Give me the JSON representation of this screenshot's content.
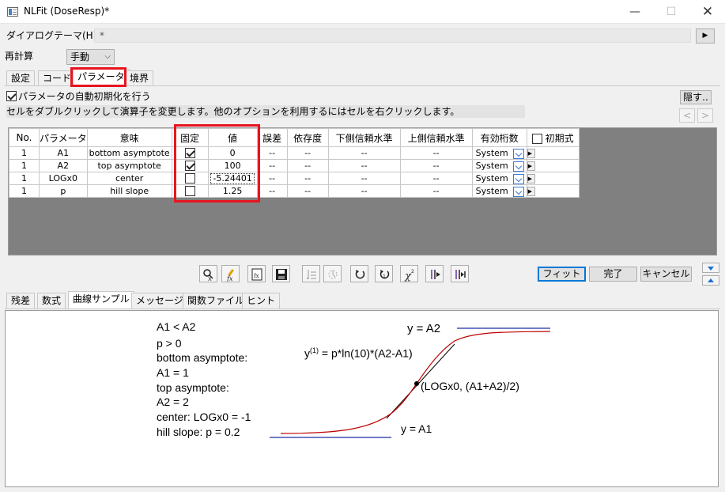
{
  "window": {
    "title": "NLFit (DoseResp)*",
    "minimize": "—",
    "maximize": "☐",
    "close": "✕"
  },
  "theme": {
    "label": "ダイアログテーマ(H)",
    "value": "*",
    "arrow": "▶"
  },
  "recalc": {
    "label": "再計算",
    "value": "手動"
  },
  "top_tabs": [
    "設定",
    "コード",
    "パラメータ",
    "境界"
  ],
  "params_tab": {
    "auto_init_label": "パラメータの自動初期化を行う",
    "auto_init_checked": true,
    "hint": "セルをダブルクリックして演算子を変更します。他のオプションを利用するにはセルを右クリックします。",
    "hide_button": "隠す..",
    "prev": "<",
    "next": ">"
  },
  "grid": {
    "headers": [
      "No.",
      "パラメータ",
      "意味",
      "固定",
      "値",
      "誤差",
      "依存度",
      "下側信頼水準",
      "上側信頼水準",
      "有効桁数",
      "初期式"
    ],
    "rows": [
      {
        "no": "1",
        "param": "A1",
        "meaning": "bottom asymptote",
        "fixed": true,
        "value": "0",
        "err": "--",
        "dep": "--",
        "lcl": "--",
        "ucl": "--",
        "sig": "System"
      },
      {
        "no": "1",
        "param": "A2",
        "meaning": "top asymptote",
        "fixed": true,
        "value": "100",
        "err": "--",
        "dep": "--",
        "lcl": "--",
        "ucl": "--",
        "sig": "System"
      },
      {
        "no": "1",
        "param": "LOGx0",
        "meaning": "center",
        "fixed": false,
        "value": "-5.24401",
        "err": "--",
        "dep": "--",
        "lcl": "--",
        "ucl": "--",
        "sig": "System"
      },
      {
        "no": "1",
        "param": "p",
        "meaning": "hill slope",
        "fixed": false,
        "value": "1.25",
        "err": "--",
        "dep": "--",
        "lcl": "--",
        "ucl": "--",
        "sig": "System"
      }
    ]
  },
  "buttons": {
    "fit": "フィット",
    "done": "完了",
    "cancel": "キャンセル"
  },
  "bottom_tabs": [
    "残差",
    "数式",
    "曲線サンプル",
    "メッセージ",
    "関数ファイル",
    "ヒント"
  ],
  "sample": {
    "conditions": [
      "A1 < A2",
      "p > 0",
      "bottom asymptote:",
      "A1 = 1",
      "top asymptote:",
      "A2 = 2",
      "center: LOGx0 = -1",
      "hill slope: p = 0.2"
    ],
    "label_top": "y = A2",
    "label_bottom": "y = A1",
    "label_center": "(LOGx0, (A1+A2)/2)",
    "label_deriv_y": "y",
    "label_deriv_sup": "(1)",
    "label_deriv_rest": " = p*ln(10)*(A2-A1)",
    "colors": {
      "curve": "#c00000",
      "asymptote": "#1f2fa8",
      "tangent": "#000000"
    }
  }
}
